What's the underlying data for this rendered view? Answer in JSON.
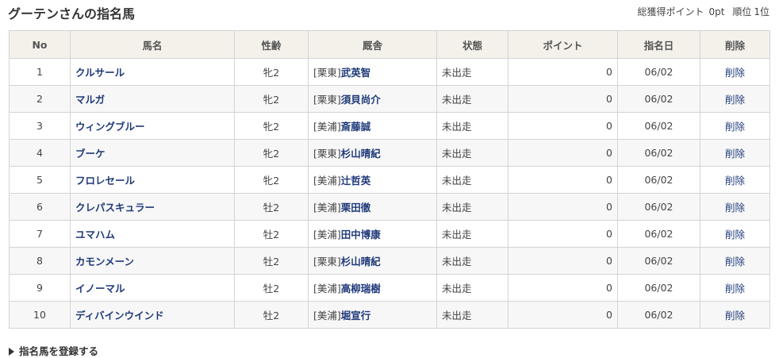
{
  "header": {
    "title": "グーテンさんの指名馬",
    "total_label": "総獲得ポイント",
    "total_value": "0pt",
    "rank_label": "順位",
    "rank_value": "1位"
  },
  "table": {
    "columns": [
      "No",
      "馬名",
      "性齢",
      "厩舎",
      "状態",
      "ポイント",
      "指名日",
      "削除"
    ],
    "rows": [
      {
        "no": "1",
        "name": "クルサール",
        "sex_age": "牝2",
        "region": "[栗東]",
        "trainer": "武英智",
        "status": "未出走",
        "points": "0",
        "date": "06/02",
        "delete": "削除"
      },
      {
        "no": "2",
        "name": "マルガ",
        "sex_age": "牝2",
        "region": "[栗東]",
        "trainer": "須貝尚介",
        "status": "未出走",
        "points": "0",
        "date": "06/02",
        "delete": "削除"
      },
      {
        "no": "3",
        "name": "ウィングブルー",
        "sex_age": "牝2",
        "region": "[美浦]",
        "trainer": "斎藤誠",
        "status": "未出走",
        "points": "0",
        "date": "06/02",
        "delete": "削除"
      },
      {
        "no": "4",
        "name": "ブーケ",
        "sex_age": "牝2",
        "region": "[栗東]",
        "trainer": "杉山晴紀",
        "status": "未出走",
        "points": "0",
        "date": "06/02",
        "delete": "削除"
      },
      {
        "no": "5",
        "name": "フロレセール",
        "sex_age": "牝2",
        "region": "[美浦]",
        "trainer": "辻哲英",
        "status": "未出走",
        "points": "0",
        "date": "06/02",
        "delete": "削除"
      },
      {
        "no": "6",
        "name": "クレパスキュラー",
        "sex_age": "牡2",
        "region": "[美浦]",
        "trainer": "栗田徹",
        "status": "未出走",
        "points": "0",
        "date": "06/02",
        "delete": "削除"
      },
      {
        "no": "7",
        "name": "ユマハム",
        "sex_age": "牡2",
        "region": "[美浦]",
        "trainer": "田中博康",
        "status": "未出走",
        "points": "0",
        "date": "06/02",
        "delete": "削除"
      },
      {
        "no": "8",
        "name": "カモンメーン",
        "sex_age": "牡2",
        "region": "[栗東]",
        "trainer": "杉山晴紀",
        "status": "未出走",
        "points": "0",
        "date": "06/02",
        "delete": "削除"
      },
      {
        "no": "9",
        "name": "イノーマル",
        "sex_age": "牡2",
        "region": "[美浦]",
        "trainer": "高柳瑞樹",
        "status": "未出走",
        "points": "0",
        "date": "06/02",
        "delete": "削除"
      },
      {
        "no": "10",
        "name": "ディバインウインド",
        "sex_age": "牡2",
        "region": "[美浦]",
        "trainer": "堀宣行",
        "status": "未出走",
        "points": "0",
        "date": "06/02",
        "delete": "削除"
      }
    ]
  },
  "footer": {
    "register_label": "指名馬を登録する",
    "register_icon": "triangle-right-icon"
  },
  "colors": {
    "link": "#1f3a7a",
    "header_bg": "#f3f1ea",
    "border": "#d4d4d4",
    "stripe": "#f7f7f7"
  }
}
